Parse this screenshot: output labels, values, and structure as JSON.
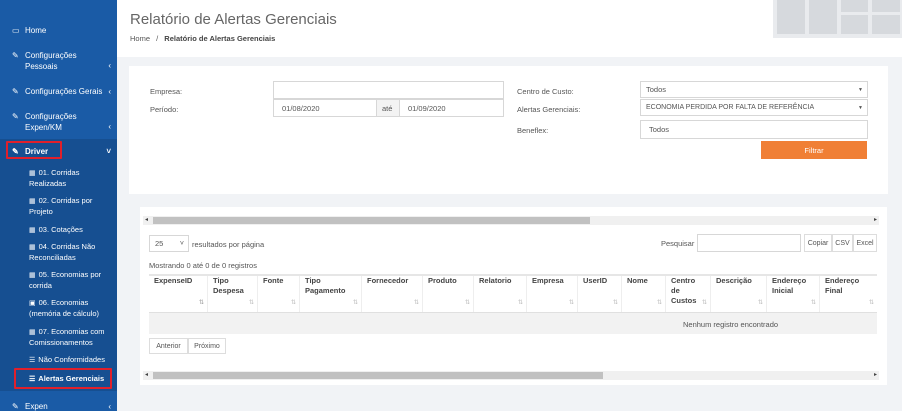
{
  "sidebar": {
    "items": [
      {
        "label": "Home",
        "icon": "monitor-icon"
      },
      {
        "label": "Configurações Pessoais",
        "icon": "edit-icon"
      },
      {
        "label": "Configurações Gerais",
        "icon": "edit-icon"
      },
      {
        "label": "Configurações Expen/KM",
        "icon": "edit-icon"
      },
      {
        "label": "Driver",
        "icon": "edit-icon"
      },
      {
        "label": "Expen",
        "icon": "edit-icon"
      }
    ],
    "driver_items": [
      "01. Corridas Realizadas",
      "02. Corridas por Projeto",
      "03. Cotações",
      "04. Corridas Não Reconciliadas",
      "05. Economias por corrida",
      "06. Economias (memória de cálculo)",
      "07. Economias com Comissionamentos",
      "Não Conformidades",
      "Alertas Gerenciais"
    ],
    "highlight_color": "#e0202b"
  },
  "header": {
    "title": "Relatório de Alertas Gerenciais",
    "breadcrumb_home": "Home",
    "breadcrumb_sep": "/",
    "breadcrumb_current": "Relatório de Alertas Gerenciais"
  },
  "filters": {
    "empresa_label": "Empresa:",
    "empresa_value": "",
    "periodo_label": "Período:",
    "periodo_start": "01/08/2020",
    "ate_label": "até",
    "periodo_end": "01/09/2020",
    "centro_label": "Centro de Custo:",
    "centro_value": "Todos",
    "alertas_label": "Alertas Gerenciais:",
    "alertas_value": "ECONOMIA PERDIDA POR FALTA DE REFERÊNCIA",
    "beneflex_label": "Beneflex:",
    "beneflex_value": "Todos",
    "filter_button": "Filtrar",
    "accent_color": "#f07f35"
  },
  "table": {
    "page_size": "25",
    "page_size_suffix": "resultados por página",
    "search_label": "Pesquisar",
    "export_buttons": [
      "Copiar",
      "CSV",
      "Excel"
    ],
    "info": "Mostrando 0 até 0 de 0 registros",
    "columns": [
      "ExpenseID",
      "Tipo Despesa",
      "Fonte",
      "Tipo Pagamento",
      "Fornecedor",
      "Produto",
      "Relatorio",
      "Empresa",
      "UserID",
      "Nome",
      "Centro de Custos",
      "Descrição",
      "Endereço Inicial",
      "Endereço Final"
    ],
    "empty_message": "Nenhum registro encontrado",
    "prev_button": "Anterior",
    "next_button": "Próximo"
  }
}
